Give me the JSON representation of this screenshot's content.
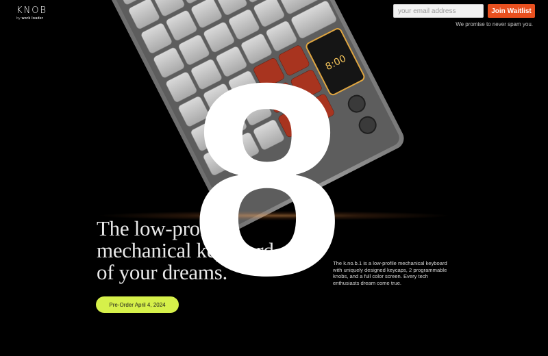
{
  "header": {
    "logo_text": "KNOB",
    "logo_by": "by",
    "logo_brand": "work louder"
  },
  "waitlist": {
    "email_placeholder": "your email address",
    "join_label": "Join Waitlist",
    "spam_note": "We promise to never spam you."
  },
  "hero": {
    "headline_line1": "The low-profile",
    "headline_line2": "mechanical keyboard",
    "headline_line3": "of your dreams.",
    "description": "The k.no.b.1 is a low-profile mechanical keyboard with uniquely designed keycaps, 2 programmable knobs, and a full color screen. Every tech enthusiasts dream come true.",
    "preorder_label": "Pre-Order April 4, 2024",
    "screen_time": "8:00"
  },
  "overlay": {
    "number": "8"
  },
  "colors": {
    "background": "#000000",
    "accent_orange": "#e8501f",
    "accent_lime": "#d6f04a",
    "keycap_red": "#a8341f"
  }
}
